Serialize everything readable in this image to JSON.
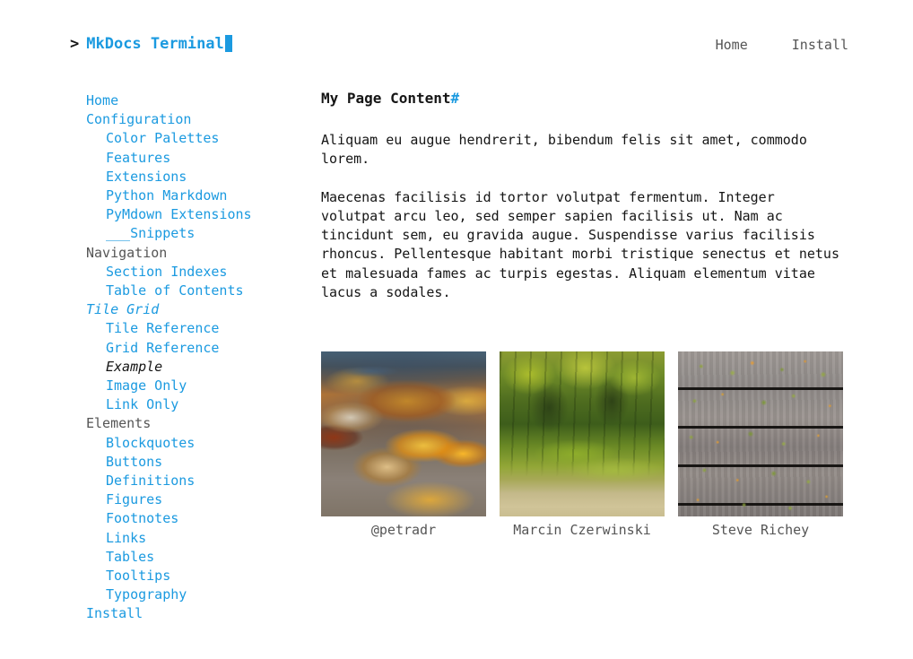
{
  "header": {
    "prompt": ">",
    "brand_title": "MkDocs Terminal",
    "nav": [
      {
        "label": "Home"
      },
      {
        "label": "Install"
      }
    ]
  },
  "sidebar": {
    "items": [
      {
        "label": "Home",
        "level": 1,
        "kind": "link"
      },
      {
        "label": "Configuration",
        "level": 1,
        "kind": "link"
      },
      {
        "label": "Color Palettes",
        "level": 2,
        "kind": "link"
      },
      {
        "label": "Features",
        "level": 2,
        "kind": "link"
      },
      {
        "label": "Extensions",
        "level": 2,
        "kind": "link"
      },
      {
        "label": "Python Markdown",
        "level": 2,
        "kind": "link"
      },
      {
        "label": "PyMdown Extensions",
        "level": 2,
        "kind": "link"
      },
      {
        "label": "___Snippets",
        "level": 2,
        "kind": "link"
      },
      {
        "label": "Navigation",
        "level": 1,
        "kind": "section"
      },
      {
        "label": "Section Indexes",
        "level": 2,
        "kind": "link"
      },
      {
        "label": "Table of Contents",
        "level": 2,
        "kind": "link"
      },
      {
        "label": "Tile Grid",
        "level": 1,
        "kind": "section-active"
      },
      {
        "label": "Tile Reference",
        "level": 2,
        "kind": "link"
      },
      {
        "label": "Grid Reference",
        "level": 2,
        "kind": "link"
      },
      {
        "label": "Example",
        "level": 2,
        "kind": "current"
      },
      {
        "label": "Image Only",
        "level": 2,
        "kind": "link"
      },
      {
        "label": "Link Only",
        "level": 2,
        "kind": "link"
      },
      {
        "label": "Elements",
        "level": 1,
        "kind": "section"
      },
      {
        "label": "Blockquotes",
        "level": 2,
        "kind": "link"
      },
      {
        "label": "Buttons",
        "level": 2,
        "kind": "link"
      },
      {
        "label": "Definitions",
        "level": 2,
        "kind": "link"
      },
      {
        "label": "Figures",
        "level": 2,
        "kind": "link"
      },
      {
        "label": "Footnotes",
        "level": 2,
        "kind": "link"
      },
      {
        "label": "Links",
        "level": 2,
        "kind": "link"
      },
      {
        "label": "Tables",
        "level": 2,
        "kind": "link"
      },
      {
        "label": "Tooltips",
        "level": 2,
        "kind": "link"
      },
      {
        "label": "Typography",
        "level": 2,
        "kind": "link"
      },
      {
        "label": "Install",
        "level": 1,
        "kind": "link"
      }
    ]
  },
  "main": {
    "title": "My Page Content",
    "title_anchor": "#",
    "paragraph_1": "Aliquam eu augue hendrerit, bibendum felis sit amet, commodo lorem.",
    "paragraph_2": "Maecenas facilisis id tortor volutpat fermentum. Integer volutpat arcu leo, sed semper sapien facilisis ut. Nam ac tincidunt sem, eu gravida augue. Suspendisse varius facilisis rhoncus. Pellentesque habitant morbi tristique senectus et netus et malesuada fames ac turpis egestas. Aliquam elementum vitae lacus a sodales.",
    "tiles": [
      {
        "caption": "@petradr",
        "art": "art-leaves",
        "alt": "autumn-leaves-photo"
      },
      {
        "caption": "Marcin Czerwinski",
        "art": "art-forest",
        "alt": "green-forest-moss-photo"
      },
      {
        "caption": "Steve Richey",
        "art": "art-planks",
        "alt": "mossy-wooden-planks-photo"
      }
    ]
  },
  "colors": {
    "link": "#1b9ae0",
    "text": "#151515",
    "muted": "#555555",
    "background": "#ffffff"
  }
}
